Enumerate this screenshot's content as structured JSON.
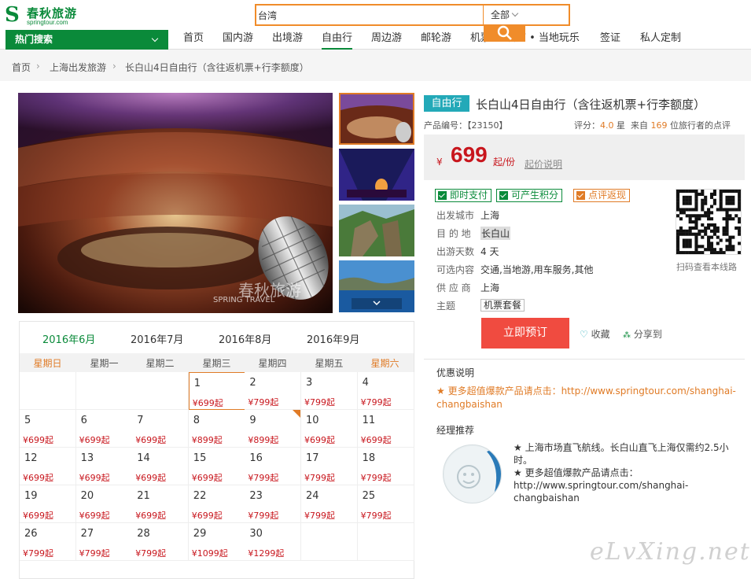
{
  "header": {
    "logo_name": "春秋旅游",
    "logo_sub": "springtour.com",
    "search_value": "台湾",
    "search_scope": "全部"
  },
  "nav": {
    "hot_search": "热门搜索",
    "items": [
      "首页",
      "国内游",
      "出境游",
      "自由行",
      "周边游",
      "邮轮游",
      "机票",
      "酒店 • 当地玩乐",
      "签证",
      "私人定制"
    ]
  },
  "breadcrumb": [
    "首页",
    "上海出发旅游",
    "长白山4日自由行（含往返机票+行李额度）"
  ],
  "gallery": {
    "watermark": "春秋旅游",
    "watermark_sub": "SPRING TRAVEL"
  },
  "calendar": {
    "months": [
      "2016年6月",
      "2016年7月",
      "2016年8月",
      "2016年9月"
    ],
    "weekdays": [
      "星期日",
      "星期一",
      "星期二",
      "星期三",
      "星期四",
      "星期五",
      "星期六"
    ],
    "weeks": [
      [
        null,
        null,
        null,
        {
          "d": "1",
          "p": "¥699起"
        },
        {
          "d": "2",
          "p": "¥799起"
        },
        {
          "d": "3",
          "p": "¥799起"
        },
        {
          "d": "4",
          "p": "¥799起"
        }
      ],
      [
        {
          "d": "5",
          "p": "¥699起"
        },
        {
          "d": "6",
          "p": "¥699起"
        },
        {
          "d": "7",
          "p": "¥699起"
        },
        {
          "d": "8",
          "p": "¥899起"
        },
        {
          "d": "9",
          "p": "¥899起"
        },
        {
          "d": "10",
          "p": "¥699起"
        },
        {
          "d": "11",
          "p": "¥699起"
        }
      ],
      [
        {
          "d": "12",
          "p": "¥699起"
        },
        {
          "d": "13",
          "p": "¥699起"
        },
        {
          "d": "14",
          "p": "¥699起"
        },
        {
          "d": "15",
          "p": "¥699起"
        },
        {
          "d": "16",
          "p": "¥799起"
        },
        {
          "d": "17",
          "p": "¥799起"
        },
        {
          "d": "18",
          "p": "¥799起"
        }
      ],
      [
        {
          "d": "19",
          "p": "¥699起"
        },
        {
          "d": "20",
          "p": "¥699起"
        },
        {
          "d": "21",
          "p": "¥699起"
        },
        {
          "d": "22",
          "p": "¥699起"
        },
        {
          "d": "23",
          "p": "¥799起"
        },
        {
          "d": "24",
          "p": "¥799起"
        },
        {
          "d": "25",
          "p": "¥799起"
        }
      ],
      [
        {
          "d": "26",
          "p": "¥799起"
        },
        {
          "d": "27",
          "p": "¥799起"
        },
        {
          "d": "28",
          "p": "¥799起"
        },
        {
          "d": "29",
          "p": "¥1099起"
        },
        {
          "d": "30",
          "p": "¥1299起"
        },
        null,
        null
      ]
    ]
  },
  "product": {
    "tag": "自由行",
    "title": "长白山4日自由行（含往返机票+行李额度）",
    "code": "产品编号：【23150】",
    "rating_label": "评分：",
    "rating_value": "4.0",
    "rating_unit": "星",
    "review_prefix": "来自",
    "review_count": "169",
    "review_suffix": "位旅行者的点评",
    "price_currency": "¥",
    "price": "699",
    "price_unit": "起/份",
    "price_note": "起价说明",
    "badges": [
      "即时支付",
      "可产生积分",
      "点评返现"
    ],
    "info": [
      {
        "label": "出发城市",
        "value": "上海"
      },
      {
        "label": "目 的 地",
        "value": "长白山"
      },
      {
        "label": "出游天数",
        "value": "4 天"
      },
      {
        "label": "可选内容",
        "value": "交通,当地游,用车服务,其他"
      },
      {
        "label": "供 应 商",
        "value": "上海"
      },
      {
        "label": "主题",
        "value": "机票套餐"
      }
    ],
    "qr_caption": "扫码查看本线路",
    "book_label": "立即预订",
    "fav_label": "收藏",
    "share_label": "分享到"
  },
  "promo": {
    "heading": "优惠说明",
    "text": "★ 更多超值爆款产品请点击：http://www.springtour.com/shanghai-changbaishan"
  },
  "manager": {
    "heading": "经理推荐",
    "line1": "★ 上海市场直飞航线。长白山直飞上海仅需约2.5小时。",
    "line2": "★ 更多超值爆款产品请点击：http://www.springtour.com/shanghai-changbaishan"
  },
  "watermark": "eLvXing.net",
  "colors": {
    "brand_green": "#0a8a3a",
    "accent_orange": "#f08c2a",
    "price_red": "#c8161d",
    "book_red": "#f04b40",
    "tag_teal": "#23a9b8"
  }
}
